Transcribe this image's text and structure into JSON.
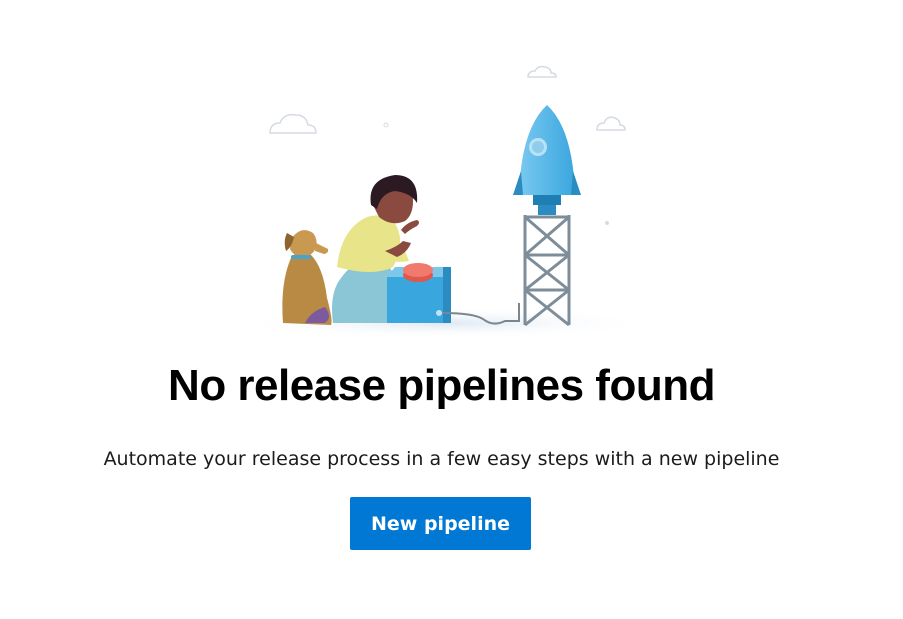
{
  "empty_state": {
    "title": "No release pipelines found",
    "subtitle": "Automate your release process in a few easy steps with a new pipeline",
    "button_label": "New pipeline"
  },
  "colors": {
    "button_bg": "#0078d4",
    "button_text": "#ffffff",
    "title_text": "#000000"
  },
  "illustration": {
    "icon": "person-dog-launching-rocket-illustration"
  }
}
